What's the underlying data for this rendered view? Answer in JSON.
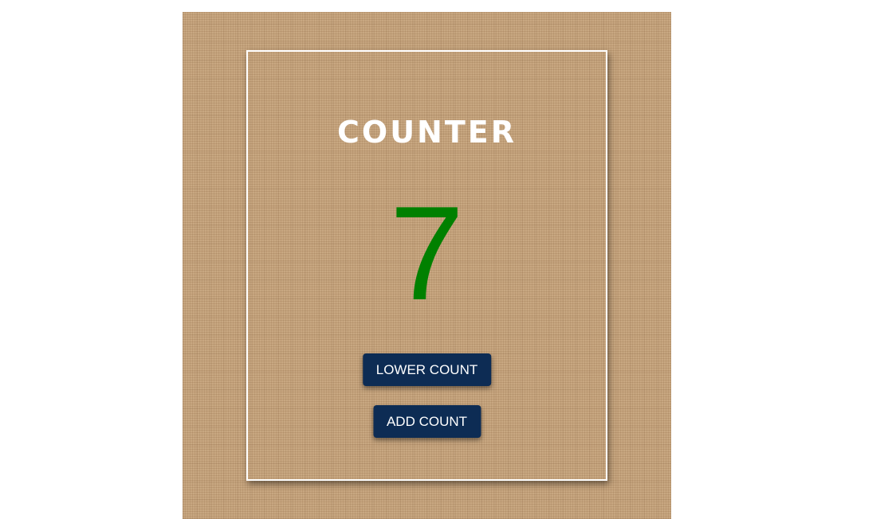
{
  "counter": {
    "title": "COUNTER",
    "value": "7",
    "value_color": "#008000",
    "lower_label": "LOWER COUNT",
    "add_label": "ADD COUNT"
  },
  "theme": {
    "background": "burlap texture",
    "button_color": "#0d2c54",
    "card_border_color": "#ffffff"
  }
}
